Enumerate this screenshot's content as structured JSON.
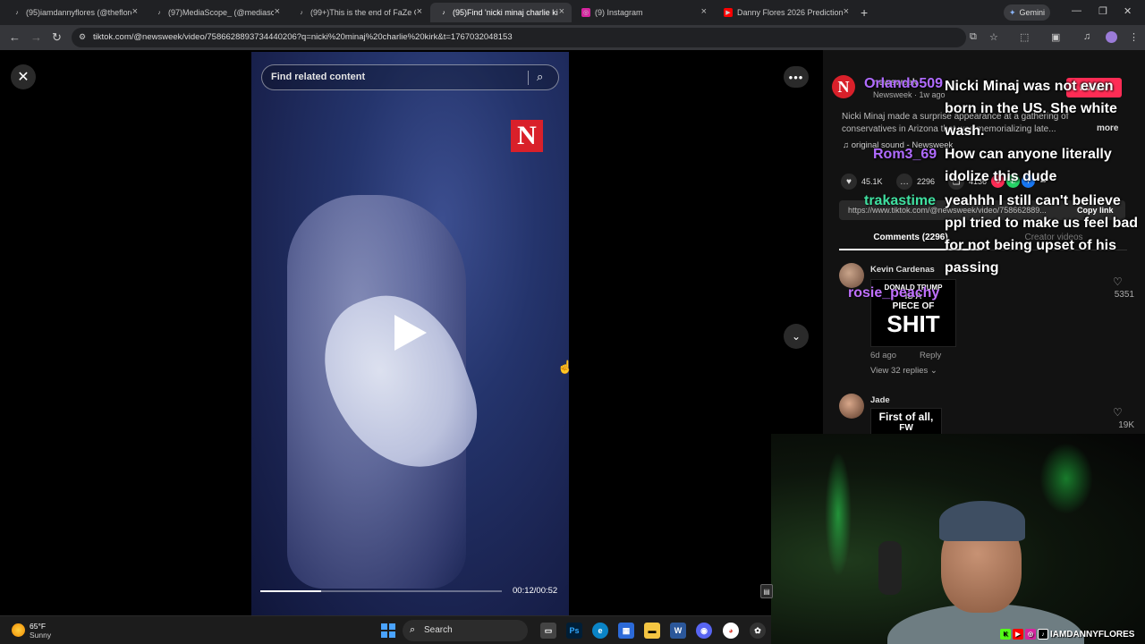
{
  "browser": {
    "tabs": [
      {
        "title": "(95)iamdannyflores (@theflores...",
        "icon": "tiktok-icon"
      },
      {
        "title": "(97)MediaScope_ (@mediascop...",
        "icon": "tiktok-icon"
      },
      {
        "title": "(99+)This is the end of FaZe Cla...",
        "icon": "tiktok-icon"
      },
      {
        "title": "(95)Find 'nicki minaj charlie kirk'...",
        "icon": "tiktok-icon",
        "active": true
      },
      {
        "title": "(9) Instagram",
        "icon": "instagram-icon"
      },
      {
        "title": "Danny Flores 2026 Predictions ...",
        "icon": "youtube-icon"
      }
    ],
    "gemini_label": "Gemini",
    "url": "tiktok.com/@newsweek/video/7586628893734440206?q=nicki%20minaj%20charlie%20kirk&t=1767032048153"
  },
  "video": {
    "search_placeholder": "Find related content",
    "logo_letter": "N",
    "progress_fraction": 0.25,
    "time": "00:12/00:52"
  },
  "post": {
    "author_id": "newsweek",
    "author_meta": "Newsweek · 1w ago",
    "follow_label": "Follow",
    "description": "Nicki Minaj made a surprise appearance at a gathering of conservatives in Arizona that was memorializing late...",
    "more_label": "more",
    "sound": "♫  original sound - Newsweek",
    "likes": "45.1K",
    "comments_count": "2296",
    "share_count": "4136",
    "link_url": "https://www.tiktok.com/@newsweek/video/758662889...",
    "copy_link_label": "Copy link",
    "tab_comments": "Comments (2296)",
    "tab_creator": "Creator videos"
  },
  "comments": [
    {
      "name": "Kevin Cardenas",
      "meme_lines": [
        "DONALD TRUMP",
        "IS A",
        "PIECE OF",
        "SHIT"
      ],
      "age": "6d ago",
      "reply_label": "Reply",
      "view_replies": "View 32 replies ⌄",
      "likes": "5351"
    },
    {
      "name": "Jade",
      "meme_lines": [
        "First of all,",
        "FW"
      ],
      "likes": "19K"
    }
  ],
  "chat": [
    {
      "user": "Orlando509",
      "user_color": "#b06bff",
      "message": "Nicki Minaj was not even born in the US. She white wash."
    },
    {
      "user": "Rom3_69",
      "user_color": "#b06bff",
      "message": "How can anyone literally idolize this dude"
    },
    {
      "user": "trakastime",
      "user_color": "#3fe0a0",
      "message": "yeahhh I still can't believe ppl tried to make us feel bad for not being upset of his passing"
    },
    {
      "user": "rosie_peachy",
      "user_color": "#c070ff",
      "message": ""
    }
  ],
  "webcam": {
    "handle": "IAMDANNYFLORES"
  },
  "taskbar": {
    "temp": "65°F",
    "condition": "Sunny",
    "search_label": "Search"
  }
}
